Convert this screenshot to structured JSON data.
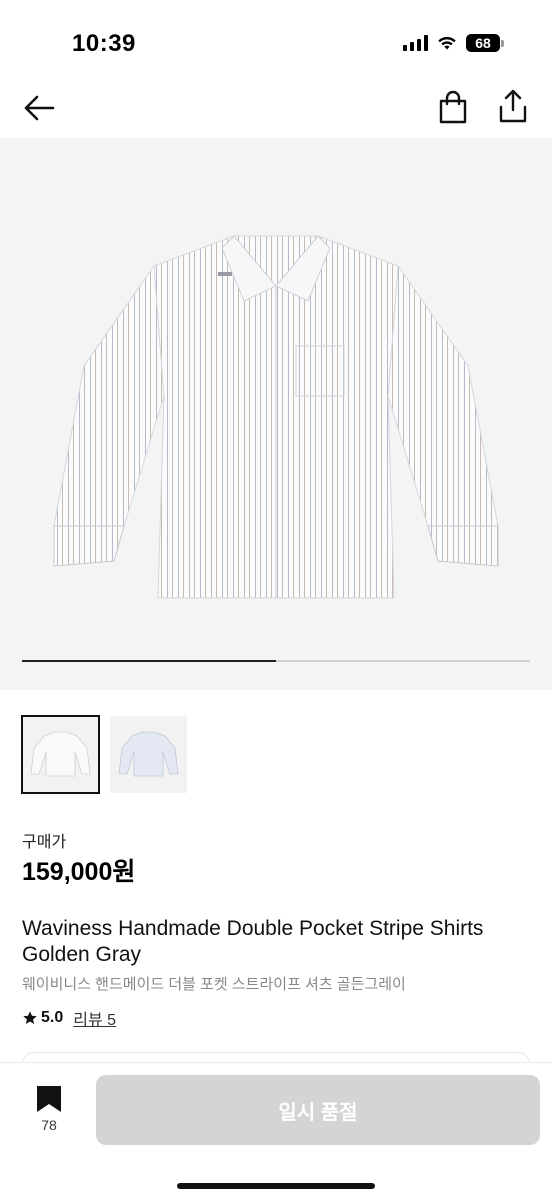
{
  "status_bar": {
    "time": "10:39",
    "battery": "68"
  },
  "gallery": {
    "progress": 0.5
  },
  "thumbnails": [
    {
      "label": "golden-gray-shirt",
      "selected": true
    },
    {
      "label": "blue-stripe-shirt",
      "selected": false
    }
  ],
  "product": {
    "price_label": "구매가",
    "price": "159,000원",
    "title_en": "Waviness Handmade Double Pocket Stripe Shirts Golden Gray",
    "title_ko": "웨이비니스 핸드메이드 더블 포켓 스트라이프 셔츠 골든그레이",
    "rating": "5.0",
    "review_label": "리뷰 5"
  },
  "bottom_bar": {
    "bookmark_count": "78",
    "cta_label": "일시 품절"
  },
  "icons": {
    "back": "back-arrow-icon",
    "bag": "shopping-bag-icon",
    "share": "share-icon",
    "star": "star-icon",
    "bookmark": "bookmark-icon"
  },
  "colors": {
    "cta_disabled": "#d4d4d4",
    "hero_bg": "#f4f4f4"
  }
}
